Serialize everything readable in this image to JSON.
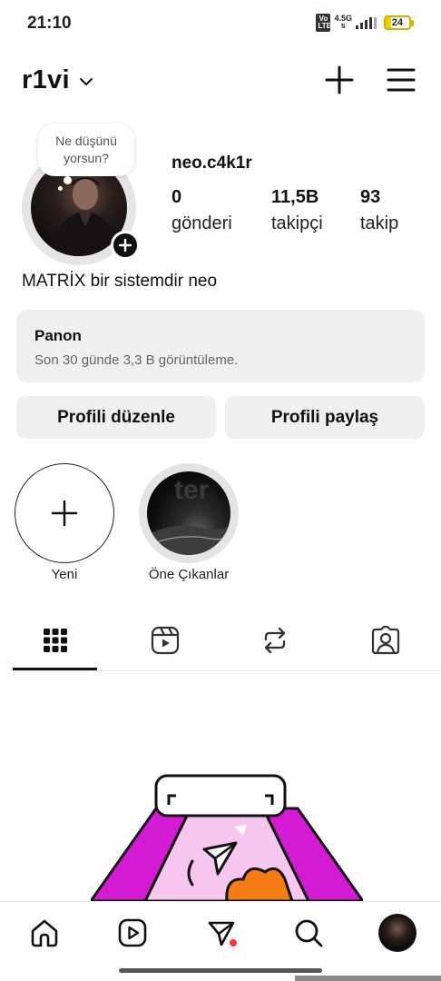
{
  "status_bar": {
    "time": "21:10",
    "volte": "Vo LTE",
    "network": "4.5G",
    "battery": "24",
    "battery_level": 0.24
  },
  "header": {
    "username": "r1vi",
    "chevron_icon": "chevron-down-icon",
    "create_icon": "plus-icon",
    "menu_icon": "hamburger-menu-icon"
  },
  "profile": {
    "note_text": "Ne düşünü yorsun?",
    "display_name": "neo.c4k1r",
    "stats": [
      {
        "value": "0",
        "label": "gönderi"
      },
      {
        "value": "11,5B",
        "label": "takipçi"
      },
      {
        "value": "93",
        "label": "takip"
      }
    ],
    "bio": "MATRİX bir sistemdir neo"
  },
  "dashboard": {
    "title": "Panon",
    "subtitle": "Son 30 günde 3,3 B görüntüleme."
  },
  "buttons": {
    "edit_profile": "Profili düzenle",
    "share_profile": "Profili paylaş"
  },
  "highlights": [
    {
      "label": "Yeni",
      "icon": "plus-icon"
    },
    {
      "label": "Öne Çıkanlar",
      "icon": "highlight-cover"
    }
  ],
  "tabs": [
    {
      "name": "posts-grid",
      "icon": "grid-icon",
      "active": true
    },
    {
      "name": "reels",
      "icon": "reels-icon",
      "active": false
    },
    {
      "name": "reposts",
      "icon": "repost-icon",
      "active": false
    },
    {
      "name": "tagged",
      "icon": "tagged-person-icon",
      "active": false
    }
  ],
  "bottom_nav": [
    {
      "name": "home",
      "icon": "home-icon"
    },
    {
      "name": "reels",
      "icon": "reels-icon"
    },
    {
      "name": "messages",
      "icon": "send-icon"
    },
    {
      "name": "search",
      "icon": "search-icon"
    },
    {
      "name": "profile",
      "icon": "profile-avatar"
    }
  ],
  "colors": {
    "text": "#111111",
    "card_bg": "#efefef",
    "notification_dot": "#ff3040",
    "illustration_magenta": "#d21bd2",
    "illustration_orange": "#f57c14",
    "battery": "#f0d000"
  }
}
